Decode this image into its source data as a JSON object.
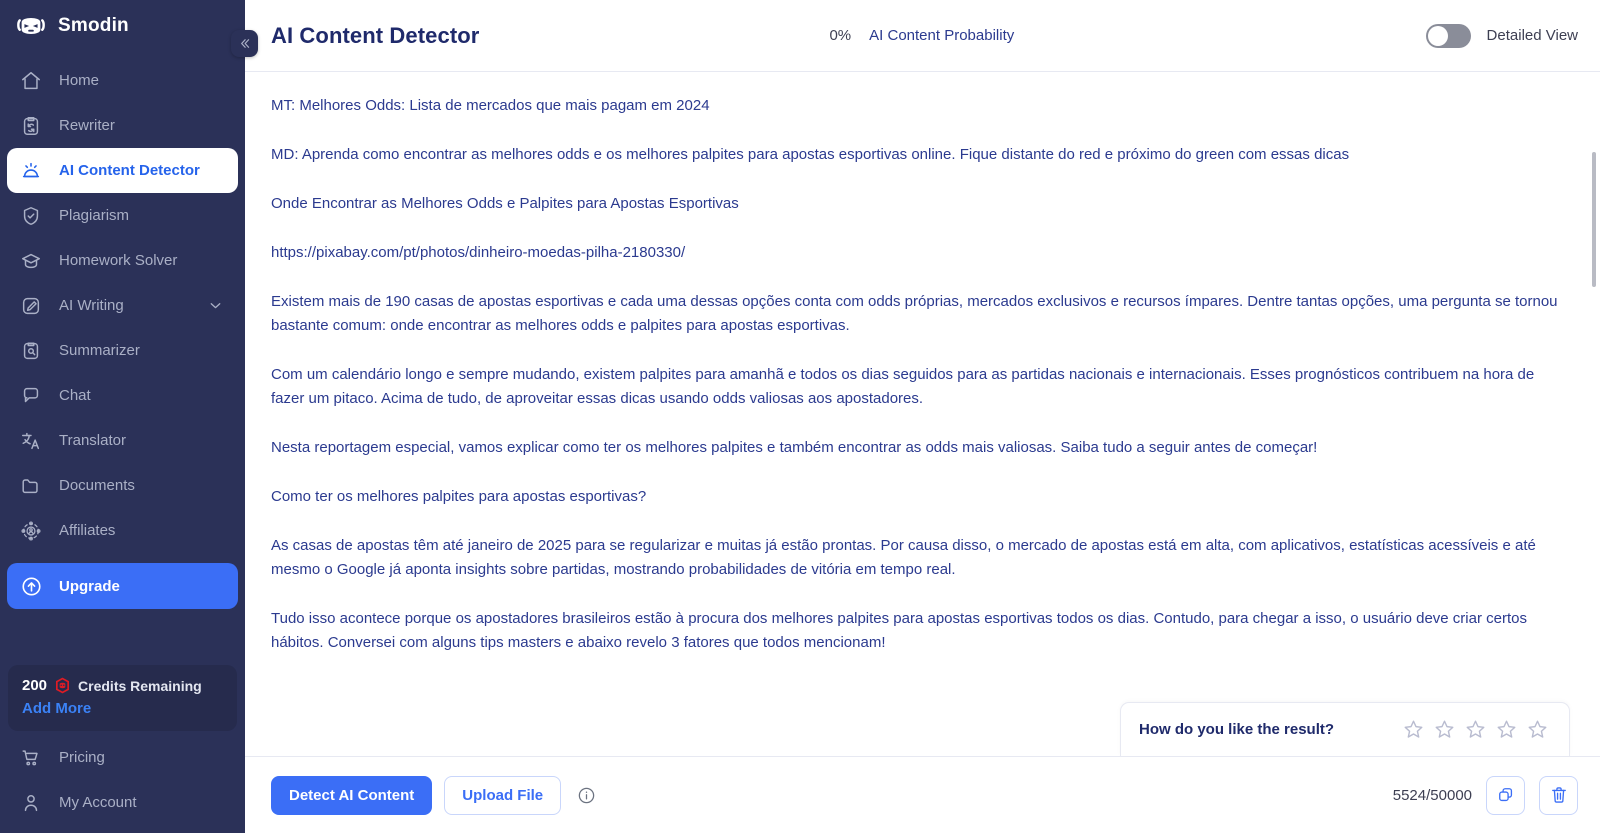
{
  "brand": {
    "name": "Smodin",
    "logo_icon": "smodin-robot-logo"
  },
  "sidebar": {
    "items": [
      {
        "label": "Home",
        "icon": "home-icon",
        "active": false
      },
      {
        "label": "Rewriter",
        "icon": "rewriter-clipboard-icon",
        "active": false
      },
      {
        "label": "AI Content Detector",
        "icon": "ai-detector-alarm-icon",
        "active": true
      },
      {
        "label": "Plagiarism",
        "icon": "shield-check-icon",
        "active": false
      },
      {
        "label": "Homework Solver",
        "icon": "graduation-cap-icon",
        "active": false
      },
      {
        "label": "AI Writing",
        "icon": "pencil-square-icon",
        "active": false,
        "expandable": true
      },
      {
        "label": "Summarizer",
        "icon": "summarizer-clipboard-icon",
        "active": false
      },
      {
        "label": "Chat",
        "icon": "chat-bubble-icon",
        "active": false
      },
      {
        "label": "Translator",
        "icon": "translate-icon",
        "active": false
      },
      {
        "label": "Documents",
        "icon": "folder-icon",
        "active": false
      },
      {
        "label": "Affiliates",
        "icon": "affiliates-network-icon",
        "active": false
      }
    ],
    "upgrade": {
      "label": "Upgrade",
      "icon": "upgrade-arrow-icon"
    },
    "credits": {
      "amount": "200",
      "badge_icon": "smodin-token-icon",
      "label": "Credits Remaining",
      "add_more_label": "Add More",
      "accent_color": "#3b82f6",
      "badge_color": "#e01b24"
    },
    "bottom_items": [
      {
        "label": "Pricing",
        "icon": "shopping-cart-icon"
      },
      {
        "label": "My Account",
        "icon": "user-icon"
      }
    ],
    "collapse_icon": "chevron-double-left-icon",
    "background_color": "#2b3158"
  },
  "topbar": {
    "title": "AI Content Detector",
    "probability_percent": "0%",
    "probability_label": "AI Content Probability",
    "detailed_view_label": "Detailed View",
    "detailed_view_on": false
  },
  "content": {
    "paragraphs": [
      "MT: Melhores Odds: Lista de mercados que mais pagam em 2024",
      "MD: Aprenda como encontrar as melhores odds e os melhores palpites para apostas esportivas online. Fique distante do red e próximo do green com essas dicas",
      "Onde Encontrar as Melhores Odds e Palpites para Apostas Esportivas",
      "https://pixabay.com/pt/photos/dinheiro-moedas-pilha-2180330/",
      "Existem mais de 190 casas de apostas esportivas e cada uma dessas opções conta com odds próprias, mercados exclusivos e recursos ímpares. Dentre tantas opções, uma pergunta se tornou bastante comum: onde encontrar as melhores odds e palpites para apostas esportivas.",
      "Com um calendário longo e sempre mudando, existem palpites para amanhã e todos os dias seguidos para as partidas nacionais e internacionais. Esses prognósticos contribuem na hora de fazer um pitaco. Acima de tudo, de aproveitar essas dicas usando odds valiosas aos apostadores.",
      "Nesta reportagem especial, vamos explicar como ter os melhores palpites e também encontrar as odds mais valiosas. Saiba tudo a seguir antes de começar!",
      "Como ter os melhores palpites para apostas esportivas?",
      "As casas de apostas têm até janeiro de 2025 para se regularizar e muitas já estão prontas. Por causa disso, o mercado de apostas está em alta, com aplicativos, estatísticas acessíveis e até mesmo o Google já aponta insights sobre partidas, mostrando probabilidades de vitória em tempo real.",
      "Tudo isso acontece porque os apostadores brasileiros estão à procura dos melhores palpites para apostas esportivas todos os dias. Contudo, para chegar a isso, o usuário deve criar certos hábitos. Conversei com alguns tips masters e abaixo revelo 3 fatores que todos mencionam!"
    ],
    "text_color": "#2b3a8f"
  },
  "rating": {
    "question": "How do you like the result?",
    "stars_total": 5,
    "stars_filled": 0,
    "star_icon": "star-outline-icon"
  },
  "footer": {
    "detect_label": "Detect AI Content",
    "upload_label": "Upload File",
    "info_icon": "info-circle-icon",
    "char_count": "5524/50000",
    "copy_icon": "copy-icon",
    "delete_icon": "trash-icon",
    "primary_color": "#3b6ef6"
  }
}
